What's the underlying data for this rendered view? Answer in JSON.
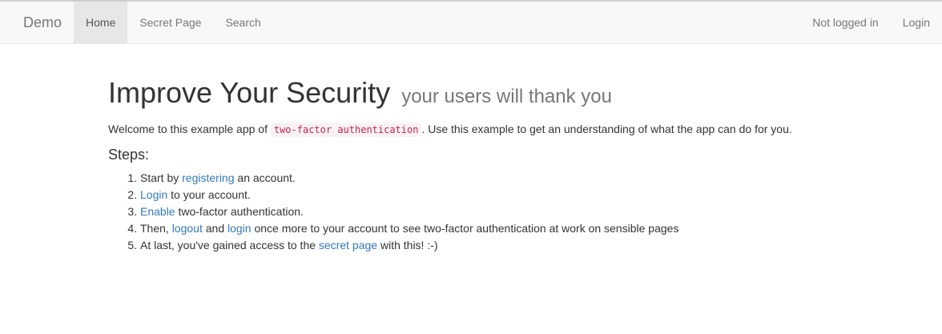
{
  "navbar": {
    "brand": "Demo",
    "left_items": [
      {
        "label": "Home",
        "active": true
      },
      {
        "label": "Secret Page"
      },
      {
        "label": "Search"
      }
    ],
    "right_items": [
      {
        "label": "Not logged in"
      },
      {
        "label": "Login"
      }
    ]
  },
  "main": {
    "title": "Improve Your Security",
    "subtitle": "your users will thank you",
    "intro_prefix": "Welcome to this example app of ",
    "intro_code": "two-factor authentication",
    "intro_suffix": ". Use this example to get an understanding of what the app can do for you.",
    "steps_heading": "Steps:",
    "steps": [
      {
        "before": "Start by ",
        "link": "registering",
        "after": " an account."
      },
      {
        "link": "Login",
        "after": " to your account."
      },
      {
        "link": "Enable",
        "after": " two-factor authentication."
      },
      {
        "before": "Then, ",
        "link": "logout",
        "mid": " and ",
        "link2": "login",
        "after": " once more to your account to see two-factor authentication at work on sensible pages"
      },
      {
        "before": "At last, you've gained access to the ",
        "link": "secret page",
        "after": " with this! :-)"
      }
    ]
  },
  "colors": {
    "link": "#337ab7",
    "navbar_bg": "#f8f8f8",
    "code_text": "#c7254e"
  }
}
